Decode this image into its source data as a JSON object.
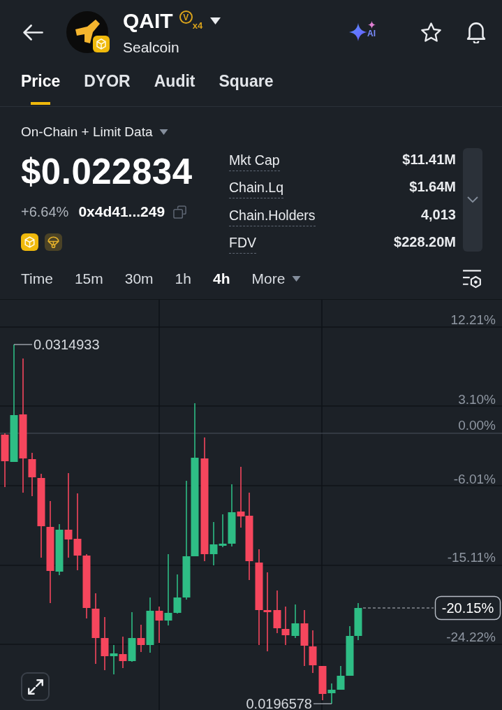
{
  "header": {
    "title": "QAIT",
    "badge_letter": "V",
    "badge_multiplier": "x4",
    "subtitle": "Sealcoin",
    "ai_label": "AI"
  },
  "tabs": [
    {
      "label": "Price",
      "selected": true
    },
    {
      "label": "DYOR",
      "selected": false
    },
    {
      "label": "Audit",
      "selected": false
    },
    {
      "label": "Square",
      "selected": false
    }
  ],
  "summary": {
    "data_source": "On-Chain + Limit Data",
    "price": "$0.022834",
    "change": "+6.64%",
    "contract": "0x4d41...249"
  },
  "stats": {
    "expanded": false,
    "rows": [
      {
        "label": "Mkt Cap",
        "value": "$11.41M"
      },
      {
        "label": "Chain.Lq",
        "value": "$1.64M"
      },
      {
        "label": "Chain.Holders",
        "value": "4,013"
      },
      {
        "label": "FDV",
        "value": "$228.20M"
      }
    ]
  },
  "intervals": [
    {
      "label": "Time",
      "kind": "option",
      "selected": false
    },
    {
      "label": "15m",
      "kind": "option",
      "selected": false
    },
    {
      "label": "30m",
      "kind": "option",
      "selected": false
    },
    {
      "label": "1h",
      "kind": "option",
      "selected": false
    },
    {
      "label": "4h",
      "kind": "option",
      "selected": true
    },
    {
      "label": "More",
      "kind": "menu",
      "selected": false
    }
  ],
  "chart": {
    "axis_labels": [
      "12.21%",
      "3.10%",
      "0.00%",
      "-6.01%",
      "-15.11%",
      "-24.22%"
    ],
    "high_label": "0.0314933",
    "low_label": "0.0196578",
    "current_label": "-20.15%"
  }
}
